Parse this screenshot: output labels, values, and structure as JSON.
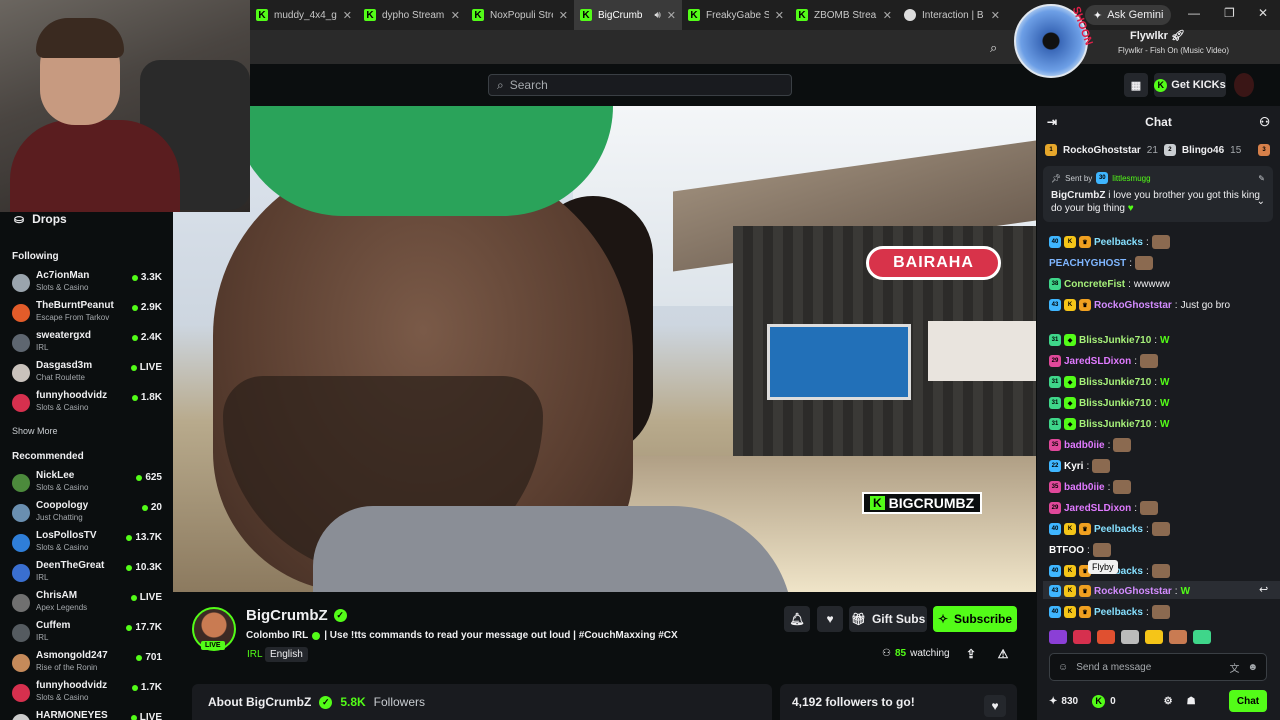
{
  "browser": {
    "tabs": [
      {
        "label": "muddy_4x4_g",
        "icon": "kick-icon",
        "active": false
      },
      {
        "label": "dypho Stream",
        "icon": "kick-icon",
        "active": false
      },
      {
        "label": "NoxPopuli Stre",
        "icon": "kick-icon",
        "active": false
      },
      {
        "label": "BigCrumb",
        "icon": "kick-icon",
        "active": true
      },
      {
        "label": "FreakyGabe S",
        "icon": "kick-icon",
        "active": false
      },
      {
        "label": "ZBOMB Strea",
        "icon": "kick-icon",
        "active": false
      },
      {
        "label": "Interaction | B",
        "icon": "gem-icon",
        "active": false
      }
    ],
    "ask_gemini": "Ask Gemini"
  },
  "music": {
    "artist": "Flywlkr",
    "track": "Flywlkr - Fish On (Music Video)"
  },
  "header": {
    "search_placeholder": "Search",
    "get_kicks": "Get KICKs"
  },
  "sidebar": {
    "drops": "Drops",
    "following_title": "Following",
    "following": [
      {
        "name": "Ac7ionMan",
        "category": "Slots & Casino",
        "viewers": "3.3K",
        "color": "#9aa4ad"
      },
      {
        "name": "TheBurntPeanut",
        "category": "Escape From Tarkov",
        "viewers": "2.9K",
        "color": "#e25c2a"
      },
      {
        "name": "sweatergxd",
        "category": "IRL",
        "viewers": "2.4K",
        "color": "#5e6670"
      },
      {
        "name": "Dasgasd3m",
        "category": "Chat Roulette",
        "viewers": "LIVE",
        "color": "#c9c2bc"
      },
      {
        "name": "funnyhoodvidz",
        "category": "Slots & Casino",
        "viewers": "1.8K",
        "color": "#d6304e"
      }
    ],
    "show_more": "Show More",
    "recommended_title": "Recommended",
    "recommended": [
      {
        "name": "NickLee",
        "category": "Slots & Casino",
        "viewers": "625",
        "color": "#4c8a3c"
      },
      {
        "name": "Coopology",
        "category": "Just Chatting",
        "viewers": "20",
        "color": "#6a8fb0"
      },
      {
        "name": "LosPollosTV",
        "category": "Slots & Casino",
        "viewers": "13.7K",
        "color": "#2f7ed8"
      },
      {
        "name": "DeenTheGreat",
        "category": "IRL",
        "viewers": "10.3K",
        "color": "#3a6fd0"
      },
      {
        "name": "ChrisAM",
        "category": "Apex Legends",
        "viewers": "LIVE",
        "color": "#707070"
      },
      {
        "name": "Cuffem",
        "category": "IRL",
        "viewers": "17.7K",
        "color": "#555b60"
      },
      {
        "name": "Asmongold247",
        "category": "Rise of the Ronin",
        "viewers": "701",
        "color": "#c58a5a"
      },
      {
        "name": "funnyhoodvidz",
        "category": "Slots & Casino",
        "viewers": "1.7K",
        "color": "#d6304e"
      },
      {
        "name": "HARMONEYES",
        "category": "",
        "viewers": "LIVE",
        "color": "#ccc"
      }
    ]
  },
  "video": {
    "sign": "BAIRAHA",
    "watermark_k": "K",
    "watermark": "BIGCRUMBZ"
  },
  "stream": {
    "name": "BigCrumbZ",
    "live": "LIVE",
    "title_prefix": "Colombo IRL",
    "title_rest": "| Use !tts commands to read your message out loud | #CouchMaxxing #CX",
    "tags": [
      "IRL",
      "English"
    ],
    "gift_subs": "Gift Subs",
    "subscribe": "Subscribe",
    "watching_count": "85",
    "watching_label": "watching",
    "about_label": "About BigCrumbZ",
    "followers_count": "5.8K",
    "followers_label": "Followers",
    "goal": "4,192 followers to go!"
  },
  "chat": {
    "title": "Chat",
    "leaderboard": [
      {
        "name": "RockoGhoststar",
        "count": "21"
      },
      {
        "name": "Blingo46",
        "count": "15"
      }
    ],
    "pinned": {
      "sent_by": "Sent by",
      "sender": "littlesmugg",
      "author": "BigCrumbZ",
      "message": "i love you brother you got this king do your big thing"
    },
    "messages": [
      {
        "badge": "40",
        "user": "Peelbacks",
        "text": "",
        "color": "#86e0ff"
      },
      {
        "badge": "",
        "user": "PEACHYGHOST",
        "text": "",
        "color": "#7fb6ff"
      },
      {
        "badge": "38",
        "user": "ConcreteFist",
        "text": "wwwww",
        "color": "#a6f07a"
      },
      {
        "badge": "43",
        "user": "RockoGhoststar",
        "text": "Just go bro",
        "color": "#d38cff"
      },
      {
        "badge": "31",
        "user": "BlissJunkie710",
        "text": "W",
        "color": "#a6f07a"
      },
      {
        "badge": "29",
        "user": "JaredSLDixon",
        "text": "",
        "color": "#e07aff"
      },
      {
        "badge": "31",
        "user": "BlissJunkie710",
        "text": "W",
        "color": "#a6f07a"
      },
      {
        "badge": "31",
        "user": "BlissJunkie710",
        "text": "W",
        "color": "#a6f07a"
      },
      {
        "badge": "31",
        "user": "BlissJunkie710",
        "text": "W",
        "color": "#a6f07a"
      },
      {
        "badge": "35",
        "user": "badb0iie",
        "text": "",
        "color": "#e07aff"
      },
      {
        "badge": "22",
        "user": "Kyri",
        "text": "",
        "color": "#ffffff"
      },
      {
        "badge": "35",
        "user": "badb0iie",
        "text": "",
        "color": "#e07aff"
      },
      {
        "badge": "29",
        "user": "JaredSLDixon",
        "text": "",
        "color": "#e07aff"
      },
      {
        "badge": "40",
        "user": "Peelbacks",
        "text": "",
        "color": "#86e0ff"
      },
      {
        "badge": "",
        "user": "BTFOO",
        "text": "",
        "color": "#ffffff"
      },
      {
        "badge": "40",
        "user": "Peelbacks",
        "text": "",
        "color": "#86e0ff"
      },
      {
        "badge": "43",
        "user": "RockoGhoststar",
        "text": "W",
        "color": "#d38cff"
      },
      {
        "badge": "40",
        "user": "Peelbacks",
        "text": "",
        "color": "#86e0ff"
      }
    ],
    "tooltip": "Flyby",
    "input_placeholder": "Send a message",
    "points": "830",
    "kicks": "0",
    "send": "Chat"
  }
}
